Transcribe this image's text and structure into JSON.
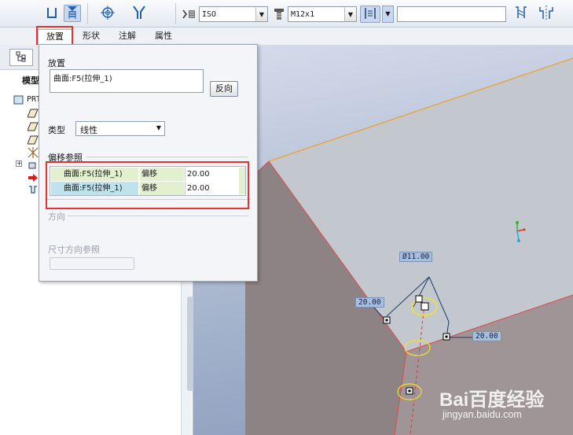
{
  "toolbar": {
    "standard_value": "ISO",
    "screw_size_value": "M12x1",
    "extra_field_value": ""
  },
  "tabs": [
    {
      "label": "放置"
    },
    {
      "label": "形状"
    },
    {
      "label": "注解"
    },
    {
      "label": "属性"
    }
  ],
  "left_panel": {
    "model_label": "模型",
    "tree_root": "PRT"
  },
  "panel": {
    "placement_label": "放置",
    "placement_item": "曲面:F5(拉伸_1)",
    "flip_button": "反向",
    "type_label": "类型",
    "type_value": "线性",
    "offset_refs_label": "偏移参照",
    "offset_refs": [
      {
        "ref": "曲面:F5(拉伸_1)",
        "kind": "偏移",
        "value": "20.00"
      },
      {
        "ref": "曲面:F5(拉伸_1)",
        "kind": "偏移",
        "value": "20.00"
      }
    ],
    "direction_label": "方向",
    "dim_direction_label": "尺寸方向参照"
  },
  "viewport": {
    "dims": {
      "diameter": "Ø11.00",
      "offset_left": "20.00",
      "offset_right": "20.00"
    }
  },
  "watermark": {
    "logo": "Bai百度经验",
    "url": "jingyan.baidu.com"
  },
  "colors": {
    "highlight": "#e8322f",
    "row_selected": "#bfe3ec",
    "row_normal": "#e2f0cd",
    "part_top": "#c3c7ce",
    "part_side": "#8e8384"
  }
}
